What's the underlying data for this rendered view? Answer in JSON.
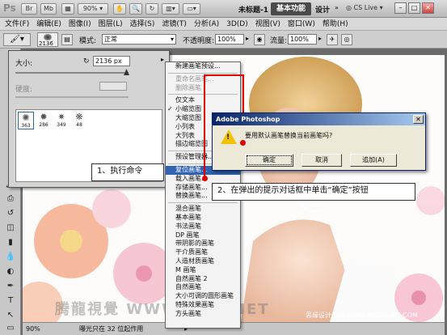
{
  "app": {
    "logo": "Ps",
    "zoom": "90%",
    "doc_title": "未标题-1",
    "workspace_active": "基本功能",
    "workspace_other": "设计",
    "cs_live": "CS Live"
  },
  "menubar": [
    "文件(F)",
    "编辑(E)",
    "图像(I)",
    "图层(L)",
    "选择(S)",
    "滤镜(T)",
    "分析(A)",
    "3D(D)",
    "视图(V)",
    "窗口(W)",
    "帮助(H)"
  ],
  "options": {
    "brush_size": "2136",
    "mode_label": "模式:",
    "mode_value": "正常",
    "opacity_label": "不透明度:",
    "opacity_value": "100%",
    "flow_label": "流量:",
    "flow_value": "100%"
  },
  "brush_panel": {
    "size_label": "大小:",
    "size_value": "2136 px",
    "hardness_label": "硬度:",
    "presets": [
      "363",
      "286",
      "349",
      "48"
    ]
  },
  "context_menu": {
    "items": [
      {
        "label": "新建画笔预设...",
        "state": "normal"
      },
      {
        "sep": true
      },
      {
        "label": "重命名画笔...",
        "state": "disabled"
      },
      {
        "label": "删除画笔",
        "state": "disabled"
      },
      {
        "sep": true
      },
      {
        "label": "仅文本",
        "state": "normal"
      },
      {
        "label": "小缩览图",
        "state": "checked"
      },
      {
        "label": "大缩览图",
        "state": "normal"
      },
      {
        "label": "小列表",
        "state": "normal"
      },
      {
        "label": "大列表",
        "state": "normal"
      },
      {
        "label": "描边缩览图",
        "state": "normal"
      },
      {
        "sep": true
      },
      {
        "label": "预设管理器...",
        "state": "normal"
      },
      {
        "sep": true
      },
      {
        "label": "复位画笔...",
        "state": "highlight"
      },
      {
        "label": "载入画笔...",
        "state": "normal"
      },
      {
        "label": "存储画笔...",
        "state": "normal"
      },
      {
        "label": "替换画笔...",
        "state": "normal"
      },
      {
        "sep": true
      },
      {
        "label": "混合画笔",
        "state": "normal"
      },
      {
        "label": "基本画笔",
        "state": "normal"
      },
      {
        "label": "书法画笔",
        "state": "normal"
      },
      {
        "label": "DP 画笔",
        "state": "normal"
      },
      {
        "label": "带阴影的画笔",
        "state": "normal"
      },
      {
        "label": "干介质画笔",
        "state": "normal"
      },
      {
        "label": "人造材质画笔",
        "state": "normal"
      },
      {
        "label": "M 画笔",
        "state": "normal"
      },
      {
        "label": "自然画笔 2",
        "state": "normal"
      },
      {
        "label": "自然画笔",
        "state": "normal"
      },
      {
        "label": "大小可调的圆形画笔",
        "state": "normal"
      },
      {
        "label": "特殊效果画笔",
        "state": "normal"
      },
      {
        "label": "方头画笔",
        "state": "normal"
      }
    ]
  },
  "dialog": {
    "title": "Adobe Photoshop",
    "message": "要用默认画笔替换当前画笔吗?",
    "ok": "确定",
    "cancel": "取消",
    "append": "追加(A)"
  },
  "callouts": {
    "step1": "1、执行命令",
    "step2": "2、在弹出的提示对话框中单击“确定”按钮"
  },
  "status": {
    "zoom": "90%",
    "info": "曝光只在 32 位起作用"
  },
  "watermarks": {
    "left": "腾龍視覺 WWW.TLVI.NET",
    "right": "思缘设计论坛 WWW.MISSYUAN.COM"
  }
}
